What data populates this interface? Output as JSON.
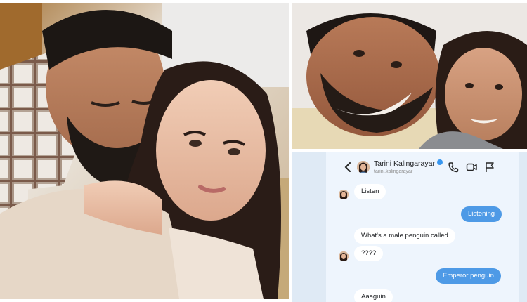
{
  "photos": [
    {
      "subject": "couple-selfie-left"
    },
    {
      "subject": "couple-selfie-bed"
    }
  ],
  "chat": {
    "contact_name": "Tarini Kalingarayar",
    "contact_handle": "tarini.kalingarayar",
    "icons": {
      "back": "chevron-left-icon",
      "verified": "verified-badge-icon",
      "call": "phone-icon",
      "video": "video-camera-icon",
      "report": "flag-icon"
    },
    "colors": {
      "outgoing_bubble": "#4e9ae6",
      "incoming_bubble": "#ffffff",
      "background": "#eef5fd"
    },
    "messages": [
      {
        "from": "them",
        "text": "Listen"
      },
      {
        "from": "me",
        "text": "Listening"
      },
      {
        "from": "them",
        "text": "What's a male penguin called"
      },
      {
        "from": "them",
        "text": "????"
      },
      {
        "from": "me",
        "text": "Emperor penguin"
      },
      {
        "from": "them",
        "text": "Aaaguin"
      }
    ]
  }
}
